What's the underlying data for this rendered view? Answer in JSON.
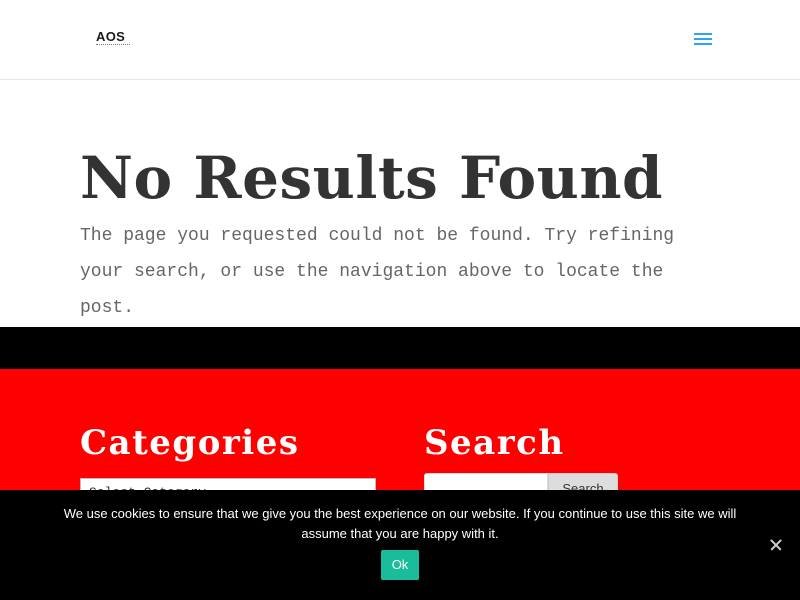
{
  "header": {
    "logo_text": "AOS",
    "menu_icon": "hamburger-menu-icon",
    "accent_color": "#2ea3f2"
  },
  "main": {
    "title": "No Results Found",
    "message": "The page you requested could not be found. Try refining your search, or use the navigation above to locate the post."
  },
  "footer": {
    "background_color": "#ff0000",
    "categories": {
      "title": "Categories",
      "select_value": "Select Category"
    },
    "search": {
      "title": "Search",
      "input_value": "",
      "button_label": "Search"
    }
  },
  "cookie": {
    "message": "We use cookies to ensure that we give you the best experience on our website. If you continue to use this site we will assume that you are happy with it.",
    "ok_label": "Ok",
    "ok_color": "#1abc9c",
    "close_icon": "close-icon"
  }
}
